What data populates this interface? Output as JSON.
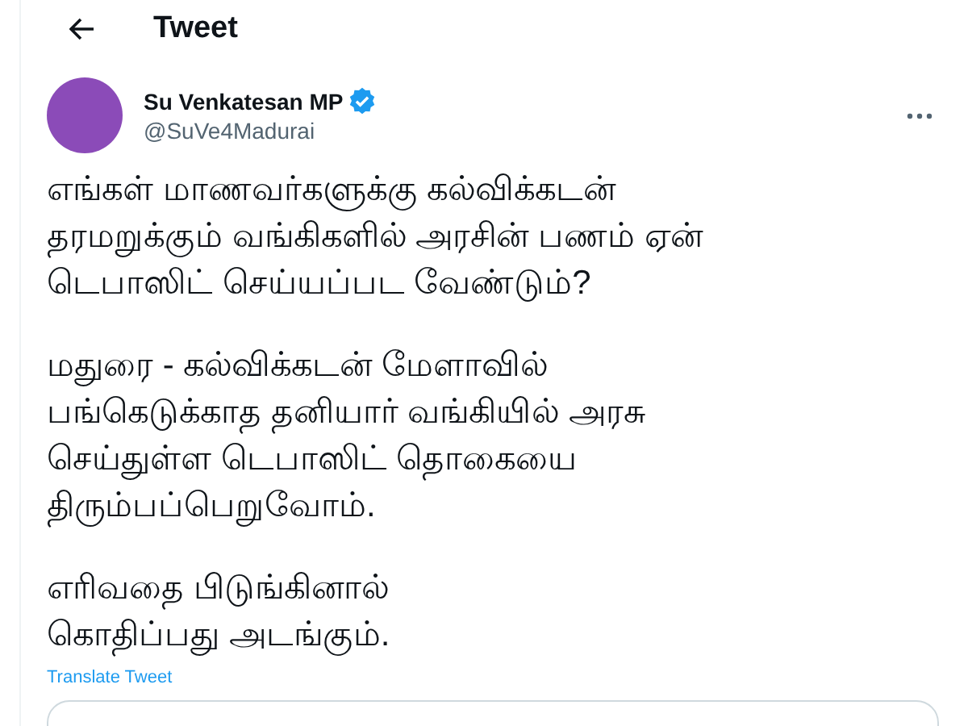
{
  "header": {
    "title": "Tweet"
  },
  "author": {
    "name": "Su Venkatesan MP",
    "handle": "@SuVe4Madurai",
    "verified": true
  },
  "body": [
    [
      "எங்கள் மாணவர்களுக்கு கல்விக்கடன்",
      "தரமறுக்கும் வங்கிகளில் அரசின் பணம் ஏன்",
      "டெபாஸிட் செய்யப்பட வேண்டும்?"
    ],
    [
      "மதுரை - கல்விக்கடன் மேளாவில்",
      "பங்கெடுக்காத தனியார் வங்கியில் அரசு",
      "செய்துள்ள டெபாஸிட் தொகையை",
      "திரும்பப்பெறுவோம்."
    ],
    [
      "எரிவதை பிடுங்கினால்",
      "கொதிப்பது அடங்கும்."
    ]
  ],
  "translate_link": "Translate Tweet"
}
